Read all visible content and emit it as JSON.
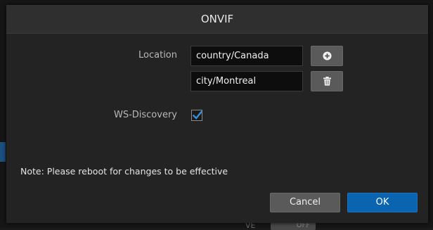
{
  "dialog": {
    "title": "ONVIF",
    "location": {
      "label": "Location",
      "values": [
        "country/Canada",
        "city/Montreal"
      ],
      "add_icon": "plus-circle-icon",
      "delete_icon": "trash-icon"
    },
    "ws_discovery": {
      "label": "WS-Discovery",
      "checked": true
    },
    "note": "Note: Please reboot for changes to be effective",
    "buttons": {
      "cancel": "Cancel",
      "ok": "OK"
    }
  },
  "background": {
    "partial_label": "VE",
    "toggle_text": "OFF"
  },
  "colors": {
    "primary": "#0a64b0",
    "checkmark": "#3a8fd8"
  }
}
